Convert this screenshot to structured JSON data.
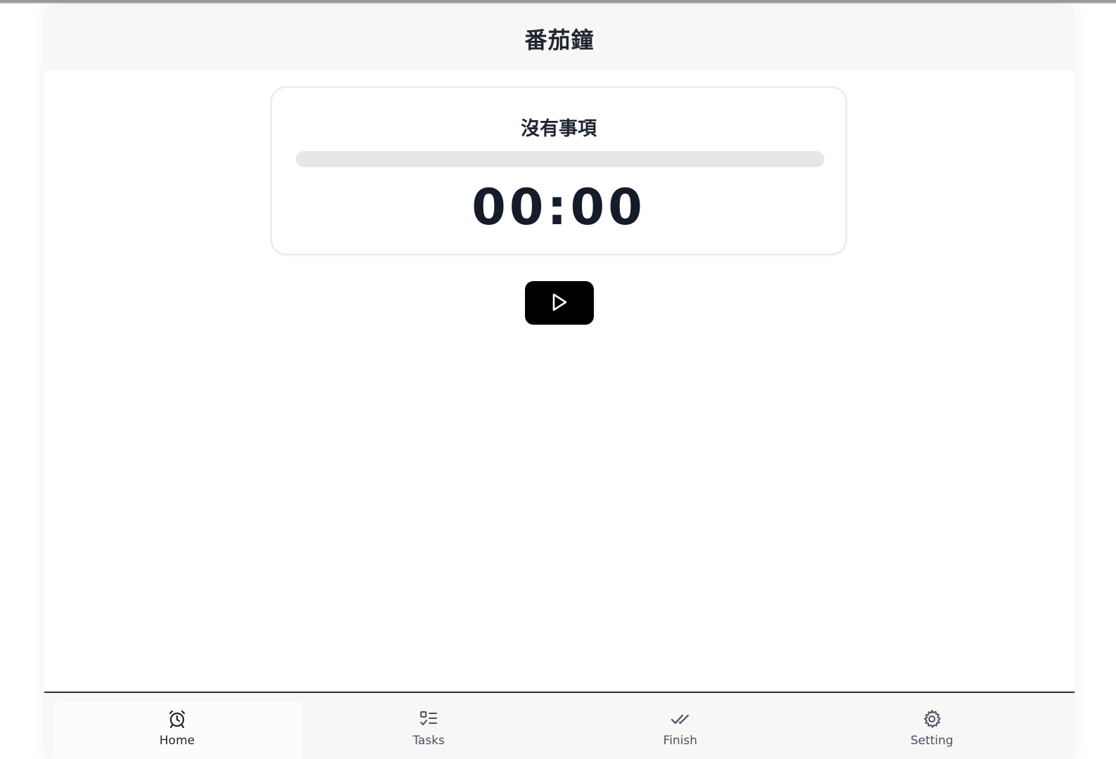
{
  "header": {
    "title": "番茄鐘"
  },
  "timer": {
    "task_title": "沒有事項",
    "progress": 0,
    "time_display": "00:00"
  },
  "controls": {
    "play_icon": "play-icon"
  },
  "nav": {
    "items": [
      {
        "label": "Home",
        "icon": "alarm-clock-icon",
        "active": true
      },
      {
        "label": "Tasks",
        "icon": "task-list-icon",
        "active": false
      },
      {
        "label": "Finish",
        "icon": "double-check-icon",
        "active": false
      },
      {
        "label": "Setting",
        "icon": "gear-icon",
        "active": false
      }
    ]
  },
  "colors": {
    "text_dark": "#1f2430",
    "progress_track": "#e5e7eb",
    "button_bg": "#000000",
    "header_bg": "#f7f7f7"
  }
}
